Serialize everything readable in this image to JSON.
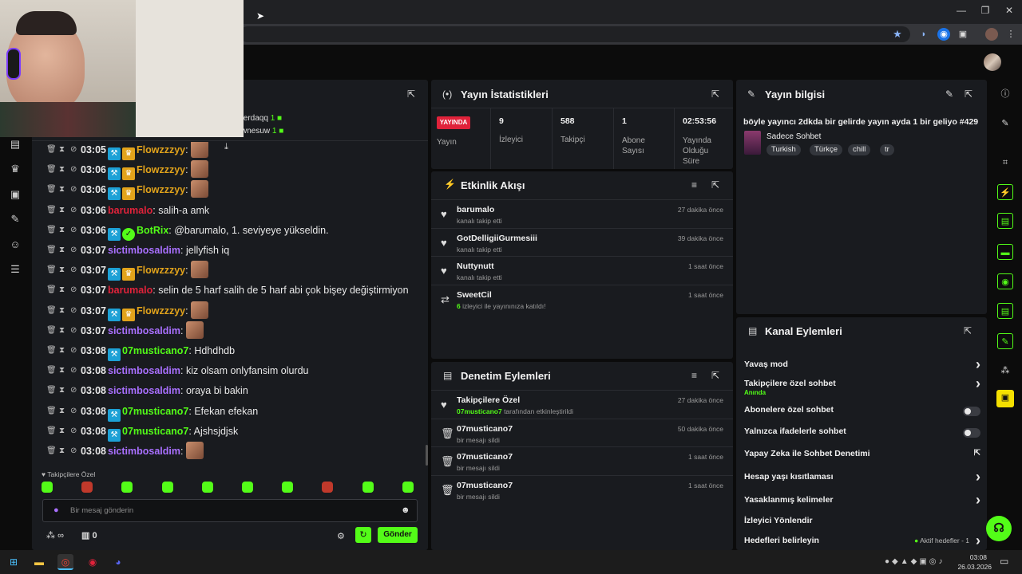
{
  "browser": {
    "star_icon": "star-icon"
  },
  "chat": {
    "header_popout": "popout-icon",
    "pinned": [
      {
        "name": "ferdaqq",
        "count": "1"
      },
      {
        "name": "wnesuw",
        "count": "1"
      }
    ],
    "messages": [
      {
        "time": "03:05",
        "user": "Flowzzzyy",
        "color": "#e2a31b",
        "badges": [
          "mod",
          "crown"
        ],
        "text": "",
        "emote": true
      },
      {
        "time": "03:06",
        "user": "Flowzzzyy",
        "color": "#e2a31b",
        "badges": [
          "mod",
          "crown"
        ],
        "text": "",
        "emote": true
      },
      {
        "time": "03:06",
        "user": "Flowzzzyy",
        "color": "#e2a31b",
        "badges": [
          "mod",
          "crown"
        ],
        "text": "",
        "emote": true
      },
      {
        "time": "03:06",
        "user": "barumalo",
        "color": "#e0223a",
        "badges": [],
        "text": "salih-a amk",
        "emote": false
      },
      {
        "time": "03:06",
        "user": "BotRix",
        "color": "#53fc18",
        "badges": [
          "mod",
          "bot"
        ],
        "text": "@barumalo, 1. seviyeye yükseldin.",
        "emote": false
      },
      {
        "time": "03:07",
        "user": "sictimbosaldim",
        "color": "#a970ff",
        "badges": [],
        "text": "jellyfish iq",
        "emote": false
      },
      {
        "time": "03:07",
        "user": "Flowzzzyy",
        "color": "#e2a31b",
        "badges": [
          "mod",
          "crown"
        ],
        "text": "",
        "emote": true
      },
      {
        "time": "03:07",
        "user": "barumalo",
        "color": "#e0223a",
        "badges": [],
        "text": "selin de 5 harf salih de 5 harf abi çok bişey değiştirmiyon",
        "emote": false
      },
      {
        "time": "03:07",
        "user": "Flowzzzyy",
        "color": "#e2a31b",
        "badges": [
          "mod",
          "crown"
        ],
        "text": "",
        "emote": true
      },
      {
        "time": "03:07",
        "user": "sictimbosaldim",
        "color": "#a970ff",
        "badges": [],
        "text": "",
        "emote": true
      },
      {
        "time": "03:08",
        "user": "07musticano7",
        "color": "#53fc18",
        "badges": [
          "mod"
        ],
        "text": "Hdhdhdb",
        "emote": false
      },
      {
        "time": "03:08",
        "user": "sictimbosaldim",
        "color": "#a970ff",
        "badges": [],
        "text": "kiz olsam onlyfansim olurdu",
        "emote": false
      },
      {
        "time": "03:08",
        "user": "sictimbosaldim",
        "color": "#a970ff",
        "badges": [],
        "text": "oraya bi bakin",
        "emote": false
      },
      {
        "time": "03:08",
        "user": "07musticano7",
        "color": "#53fc18",
        "badges": [
          "mod"
        ],
        "text": "Efekan efekan",
        "emote": false
      },
      {
        "time": "03:08",
        "user": "07musticano7",
        "color": "#53fc18",
        "badges": [
          "mod"
        ],
        "text": "Ajshsjdjsk",
        "emote": false
      },
      {
        "time": "03:08",
        "user": "sictimbosaldim",
        "color": "#a970ff",
        "badges": [],
        "text": "",
        "emote": true
      }
    ],
    "followers_only_label": "Takipçilere Özel",
    "input_placeholder": "Bir mesaj gönderin",
    "points": "∞",
    "drops": "0",
    "send_label": "Gönder"
  },
  "stats": {
    "title": "Yayın İstatistikleri",
    "live_badge": "YAYINDA",
    "live_label": "Yayın",
    "cells": [
      {
        "value": "9",
        "label": "İzleyici"
      },
      {
        "value": "588",
        "label": "Takipçi"
      },
      {
        "value": "1",
        "label": "Abone Sayısı"
      },
      {
        "value": "02:53:56",
        "label": "Yayında Olduğu Süre"
      }
    ]
  },
  "activity": {
    "title": "Etkinlik Akışı",
    "events": [
      {
        "icon": "heart-icon",
        "name": "barumalo",
        "desc": "kanalı takip etti",
        "time": "27 dakika önce"
      },
      {
        "icon": "heart-icon",
        "name": "GotDelligiiGurmesiii",
        "desc": "kanalı takip etti",
        "time": "39 dakika önce"
      },
      {
        "icon": "heart-icon",
        "name": "Nuttynutt",
        "desc": "kanalı takip etti",
        "time": "1 saat önce"
      },
      {
        "icon": "host-icon",
        "name": "SweetCil",
        "desc_green": "6",
        "desc": " izleyici ile yayınınıza katıldı!",
        "time": "1 saat önce"
      }
    ]
  },
  "moderation": {
    "title": "Denetim Eylemleri",
    "events": [
      {
        "icon": "heart-icon",
        "name": "Takipçilere Özel",
        "desc_green": "07musticano7",
        "desc": " tarafından etkinleştirildi",
        "time": "27 dakika önce"
      },
      {
        "icon": "trash-icon",
        "name": "07musticano7",
        "desc": "bir mesajı sildi",
        "time": "50 dakika önce"
      },
      {
        "icon": "trash-icon",
        "name": "07musticano7",
        "desc": "bir mesajı sildi",
        "time": "1 saat önce"
      },
      {
        "icon": "trash-icon",
        "name": "07musticano7",
        "desc": "bir mesajı sildi",
        "time": "1 saat önce"
      }
    ]
  },
  "info": {
    "title": "Yayın bilgisi",
    "stream_title": "böyle yayıncı 2dkda bir gelirde yayın ayda 1 bir geliyo #429",
    "category": "Sadece Sohbet",
    "tags": [
      "Turkish",
      "Türkçe",
      "chill",
      "tr"
    ]
  },
  "channel_actions": {
    "title": "Kanal Eylemleri",
    "items": [
      {
        "label": "Yavaş mod",
        "type": "chevron"
      },
      {
        "label": "Takipçilere özel sohbet",
        "sub": "Anında",
        "type": "chevron"
      },
      {
        "label": "Abonelere özel sohbet",
        "type": "toggle"
      },
      {
        "label": "Yalnızca ifadelerle sohbet",
        "type": "toggle"
      },
      {
        "label": "Yapay Zeka ile Sohbet Denetimi",
        "type": "external"
      },
      {
        "label": "Hesap yaşı kısıtlaması",
        "type": "chevron"
      },
      {
        "label": "Yasaklanmış kelimeler",
        "type": "chevron"
      },
      {
        "label": "İzleyici Yönlendir",
        "type": "none"
      },
      {
        "label": "Hedefleri belirleyin",
        "type": "goal",
        "goal_text": "Aktif hedefler - 1"
      }
    ]
  },
  "taskbar": {
    "time": "03:08",
    "date": "26.03.2026"
  },
  "colors": {
    "accent": "#53fc18",
    "panel": "#191b1f",
    "bg": "#0b0b0b"
  }
}
